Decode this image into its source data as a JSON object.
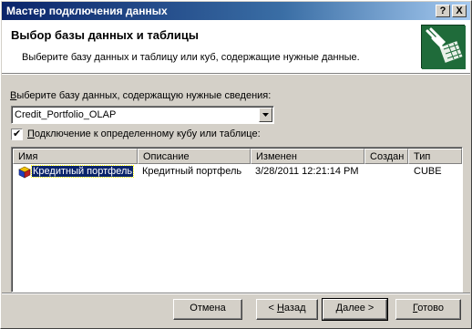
{
  "window": {
    "title": "Мастер подключения данных",
    "help_glyph": "?",
    "close_glyph": "X"
  },
  "header": {
    "title": "Выбор базы данных и таблицы",
    "subtitle": "Выберите базу данных и таблицу или куб, содержащие нужные данные.",
    "icon": "data-connection-plug-icon"
  },
  "database": {
    "label_prefix": "В",
    "label_rest": "ыберите базу данных, содержащую нужные сведения:",
    "selected": "Credit_Portfolio_OLAP"
  },
  "cube_checkbox": {
    "checked": true,
    "check_glyph": "✔",
    "label_prefix": "П",
    "label_rest": "одключение к определенному кубу или таблице:"
  },
  "table": {
    "columns": [
      "Имя",
      "Описание",
      "Изменен",
      "Создан",
      "Тип"
    ],
    "rows": [
      {
        "name": "Кредитный портфель",
        "description": "Кредитный портфель",
        "modified": "3/28/2011 12:21:14 PM",
        "created": "",
        "type": "CUBE",
        "icon": "cube-icon",
        "selected": true
      }
    ]
  },
  "buttons": {
    "cancel": "Отмена",
    "back_prefix": "< ",
    "back_mnemonic": "Н",
    "back_rest": "азад",
    "next_mnemonic": "Д",
    "next_rest": "алее >",
    "finish_mnemonic": "Г",
    "finish_rest": "отово"
  }
}
